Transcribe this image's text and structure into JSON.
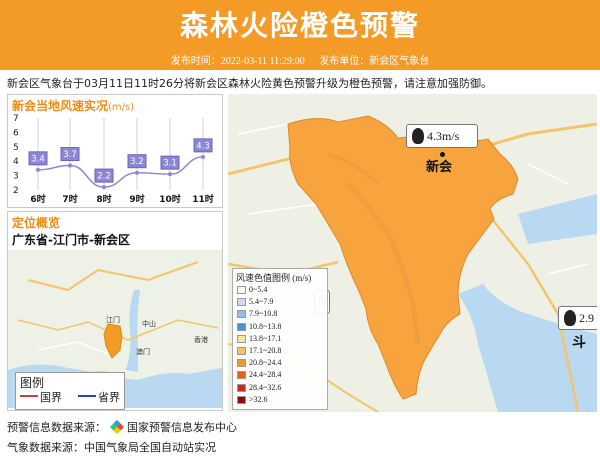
{
  "header": {
    "title": "森林火险橙色预警",
    "publish_time": "发布时间：2022-03-11 11:29:00",
    "publisher": "发布单位：新会区气象台"
  },
  "notice": "新会区气象台于03月11日11时26分将新会区森林火险黄色预警升级为橙色预警，请注意加强防御。",
  "wind_panel": {
    "title": "新会当地风速实况",
    "unit": "(m/s)",
    "y_ticks": [
      "2",
      "3",
      "4",
      "5",
      "6",
      "7"
    ]
  },
  "chart_data": {
    "type": "line",
    "title": "新会当地风速实况(m/s)",
    "categories": [
      "6时",
      "7时",
      "8时",
      "9时",
      "10时",
      "11时"
    ],
    "values": [
      3.4,
      3.7,
      2.2,
      3.2,
      3.1,
      4.3
    ],
    "ylim": [
      2,
      7
    ],
    "grid": "vertical",
    "colors": {
      "line": "#8d86d4",
      "label_bg": "#8d86d4"
    }
  },
  "location_panel": {
    "title": "定位概览",
    "location": "广东省-江门市-新会区",
    "map_labels": {
      "zhongshan": "中山",
      "jiangmen": "江门",
      "macau": "澳门",
      "hongkong": "香港"
    },
    "legend": {
      "title": "图例",
      "items": [
        "国界",
        "省界"
      ],
      "colors": [
        "#d63b3b",
        "#1f3fd6"
      ]
    }
  },
  "main_map": {
    "town_label": "新会",
    "station_labels": [
      "4.3m/s",
      "2.9",
      "斗"
    ],
    "legend_title": "风速色值图例 (m/s)",
    "legend_items": [
      {
        "label": "0~5.4",
        "color": "#f7f7f7"
      },
      {
        "label": "5.4~7.9",
        "color": "#c8dcf2"
      },
      {
        "label": "7.9~10.8",
        "color": "#93bde8"
      },
      {
        "label": "10.8~13.8",
        "color": "#4f8fdc"
      },
      {
        "label": "13.8~17.1",
        "color": "#f6e7a0"
      },
      {
        "label": "17.1~20.8",
        "color": "#f4c46a"
      },
      {
        "label": "20.8~24.4",
        "color": "#f39a27"
      },
      {
        "label": "24.4~28.4",
        "color": "#e5621a"
      },
      {
        "label": "28.4~32.6",
        "color": "#cc2a1a"
      },
      {
        "label": ">32.6",
        "color": "#8f0a0a"
      }
    ]
  },
  "footer": {
    "warning_source_label": "预警信息数据来源：",
    "warning_source": "国家预警信息发布中心",
    "weather_source": "气象数据来源：中国气象局全国自动站实况"
  },
  "colors": {
    "accent": "#f39a27",
    "region_fill": "#f7a43e",
    "sea": "#b9d8f2"
  }
}
